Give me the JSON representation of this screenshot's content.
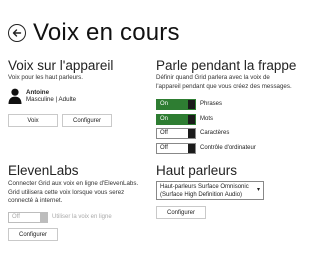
{
  "header": {
    "title": "Voix en cours"
  },
  "device_voice": {
    "title": "Voix sur l'appareil",
    "description": "Voix pour les haut parleurs.",
    "voice_name": "Antoine",
    "voice_meta": "Masculine | Adulte",
    "voice_button": "Voix",
    "configure_button": "Configurer"
  },
  "speak_while_typing": {
    "title": "Parle pendant la frappe",
    "description": "Définir quand Grid parlera avec la voix de l'appareil pendant que vous créez des messages.",
    "options": [
      {
        "label": "Phrases",
        "state": "On"
      },
      {
        "label": "Mots",
        "state": "On"
      },
      {
        "label": "Caractères",
        "state": "Off"
      },
      {
        "label": "Contrôle d'ordinateur",
        "state": "Off"
      }
    ]
  },
  "elevenlabs": {
    "title": "ElevenLabs",
    "description": "Connecter Grid aux voix en ligne d'ElevenLabs. Grid utilisera cette voix lorsque vous serez connecté à internet.",
    "toggle_state": "Off",
    "toggle_label": "Utiliser la voix en ligne",
    "configure_button": "Configurer"
  },
  "speakers": {
    "title": "Haut parleurs",
    "selected": "Haut-parleurs Surface Omnisonic (Surface High Definition Audio)",
    "configure_button": "Configurer"
  },
  "colors": {
    "toggle_on": "#2e7d32",
    "toggle_thumb": "#1b1b1b"
  }
}
